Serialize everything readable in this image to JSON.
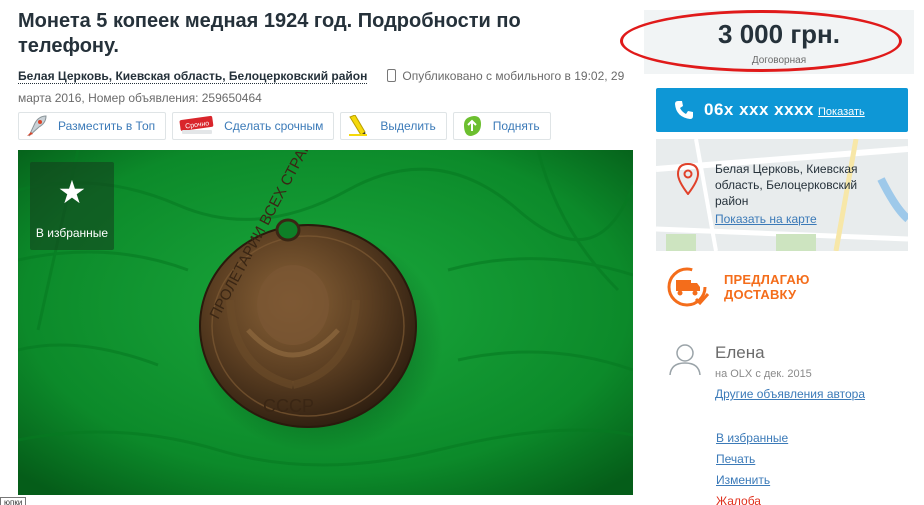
{
  "listing": {
    "title": "Монета 5 копеек медная 1924 год. Подробности по телефону.",
    "location": "Белая Церковь, Киевская область, Белоцерковский район",
    "published": "Опубликовано с мобильного в 19:02, 29 марта 2016, Номер объявления: 259650464"
  },
  "promo": {
    "top": "Разместить в Топ",
    "urgent": "Сделать срочным",
    "urgent_badge": "Срочно",
    "highlight": "Выделить",
    "bump": "Поднять"
  },
  "photo": {
    "favorite_label": "В избранные",
    "coin_inscription_top": "ПРОЛЕТАРИИ ВСЕХ СТРАН",
    "coin_inscription_bottom": "СССР"
  },
  "corner_label": "юпки",
  "price": {
    "value": "3 000 грн.",
    "note": "Договорная"
  },
  "contact": {
    "phone": "06x xxx xxxx",
    "show": "Показать"
  },
  "map": {
    "address": "Белая Церковь, Киевская область, Белоцерковский район",
    "show_on_map": "Показать на карте"
  },
  "delivery": {
    "line1": "ПРЕДЛАГАЮ",
    "line2": "ДОСТАВКУ"
  },
  "seller": {
    "name": "Елена",
    "since": "на OLX с дек. 2015",
    "other_ads": "Другие объявления автора"
  },
  "actions": {
    "favorite": "В избранные",
    "print": "Печать",
    "edit": "Изменить",
    "report": "Жалоба"
  },
  "colors": {
    "accent": "#0e97d6",
    "link": "#3b7ab8",
    "delivery": "#f46d1b",
    "highlight_ring": "#e01a1a",
    "photo_background": "#0f8a2c"
  }
}
